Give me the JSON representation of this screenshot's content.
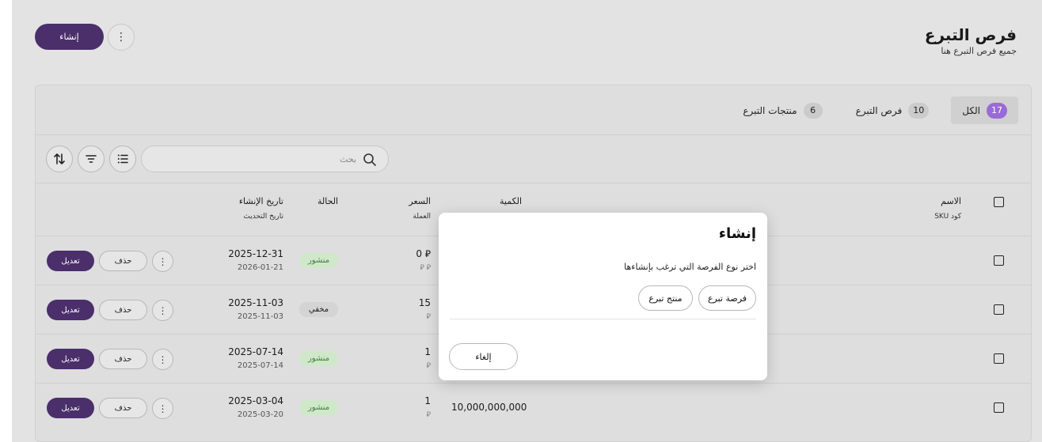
{
  "header": {
    "title": "فرص التبرع",
    "subtitle": "جميع فرص التبرع هنا",
    "create_label": "إنشاء",
    "more_label": "⋮"
  },
  "tabs": [
    {
      "label": "الكل",
      "count": "17",
      "active": true
    },
    {
      "label": "فرص التبرع",
      "count": "10",
      "active": false
    },
    {
      "label": "منتجات التبرع",
      "count": "6",
      "active": false
    }
  ],
  "search": {
    "placeholder": "بحث"
  },
  "columns": {
    "name": "الاسم",
    "sku": "كود SKU",
    "quantity": "الكمية",
    "price": "السعر",
    "currency": "العملة",
    "status": "الحالة",
    "created": "تاريخ الإنشاء",
    "updated": "تاريخ التحديث"
  },
  "rows": [
    {
      "created": "2025-12-31",
      "updated": "2026-01-21",
      "status": "منشور",
      "status_type": "pub",
      "price": "0 ⃁",
      "currency": "⃁ ⃁",
      "quantity": ""
    },
    {
      "created": "2025-11-03",
      "updated": "2025-11-03",
      "status": "مخفي",
      "status_type": "hid",
      "price": "15",
      "currency": "⃁",
      "quantity": ""
    },
    {
      "created": "2025-07-14",
      "updated": "2025-07-14",
      "status": "منشور",
      "status_type": "pub",
      "price": "1",
      "currency": "⃁",
      "quantity": ""
    },
    {
      "created": "2025-03-04",
      "updated": "2025-03-20",
      "status": "منشور",
      "status_type": "pub",
      "price": "1",
      "currency": "⃁",
      "quantity": "10,000,000,000"
    }
  ],
  "row_actions": {
    "edit": "تعديل",
    "delete": "حذف",
    "more": "⋮"
  },
  "modal": {
    "title": "إنشاء",
    "description": "اختر نوع الفرصة التي ترغب بإنشاءها",
    "option_opportunity": "فرصة تبرع",
    "option_product": "منتج تبرع",
    "cancel": "إلغاء"
  },
  "colors": {
    "primary": "#4a2f6b",
    "accent": "#9a6ad6",
    "published_bg": "#cfe8c9",
    "published_text": "#4a7f45"
  }
}
